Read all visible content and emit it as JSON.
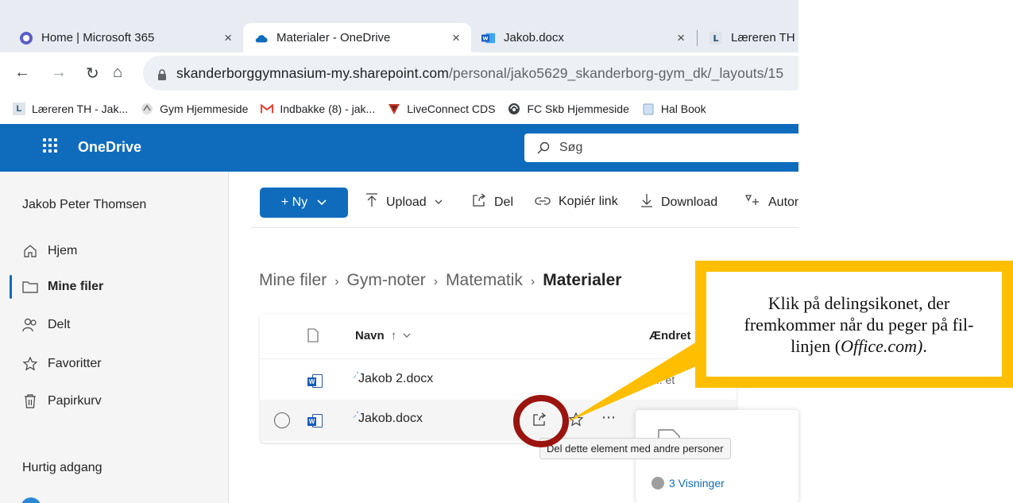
{
  "browser": {
    "tabs": [
      {
        "label": "Home | Microsoft 365",
        "icon": "m365-icon"
      },
      {
        "label": "Materialer - OneDrive",
        "icon": "onedrive-cloud-icon",
        "active": true
      },
      {
        "label": "Jakob.docx",
        "icon": "word-icon"
      },
      {
        "label": "Læreren TH",
        "icon": "lectio-icon"
      }
    ],
    "close_glyph": "×",
    "url_host": "skanderborggymnasium-my.sharepoint.com",
    "url_path": "/personal/jako5629_skanderborg-gym_dk/_layouts/15",
    "bookmarks": [
      {
        "label": "Læreren TH - Jak...",
        "icon": "lectio-icon"
      },
      {
        "label": "Gym Hjemmeside",
        "icon": "gym-logo-icon"
      },
      {
        "label": "Indbakke (8) - jak...",
        "icon": "gmail-icon"
      },
      {
        "label": "LiveConnect CDS",
        "icon": "liveconnect-icon"
      },
      {
        "label": "FC Skb Hjemmeside",
        "icon": "globe-icon"
      },
      {
        "label": "Hal Book",
        "icon": "folder-icon"
      }
    ]
  },
  "suite": {
    "app_name": "OneDrive",
    "search_placeholder": "Søg"
  },
  "nav": {
    "user": "Jakob Peter Thomsen",
    "items": [
      {
        "label": "Hjem",
        "icon": "home-icon"
      },
      {
        "label": "Mine filer",
        "icon": "folder-icon",
        "active": true
      },
      {
        "label": "Delt",
        "icon": "people-icon"
      },
      {
        "label": "Favoritter",
        "icon": "star-icon"
      },
      {
        "label": "Papirkurv",
        "icon": "trash-icon"
      }
    ],
    "quick_access": "Hurtig adgang"
  },
  "commands": {
    "new_label": "+ Ny",
    "upload": "Upload",
    "share": "Del",
    "copy_link": "Kopiér link",
    "download": "Download",
    "automate": "Autom"
  },
  "breadcrumb": {
    "items": [
      "Mine filer",
      "Gym-noter",
      "Matematik"
    ],
    "current": "Materialer"
  },
  "list": {
    "col_name": "Navn",
    "col_modified": "Ændret",
    "rows": [
      {
        "name": "Jakob 2.docx",
        "modified_partial": "... et"
      },
      {
        "name": "Jakob.docx"
      }
    ]
  },
  "tooltip": "Del dette element med andre personer",
  "detail": {
    "views": "3 Visninger"
  },
  "annotation": {
    "text_plain": "Klik på delingsikonet, der fremkommer når du peger på fil-linjen (",
    "text_italic": "Office.com)",
    "text_end": ".",
    "callout_color": "#ffbf00",
    "circle_color": "#9b1410"
  },
  "colors": {
    "brand_blue": "#0f6cbd",
    "tabstrip": "#e8ecf2"
  }
}
